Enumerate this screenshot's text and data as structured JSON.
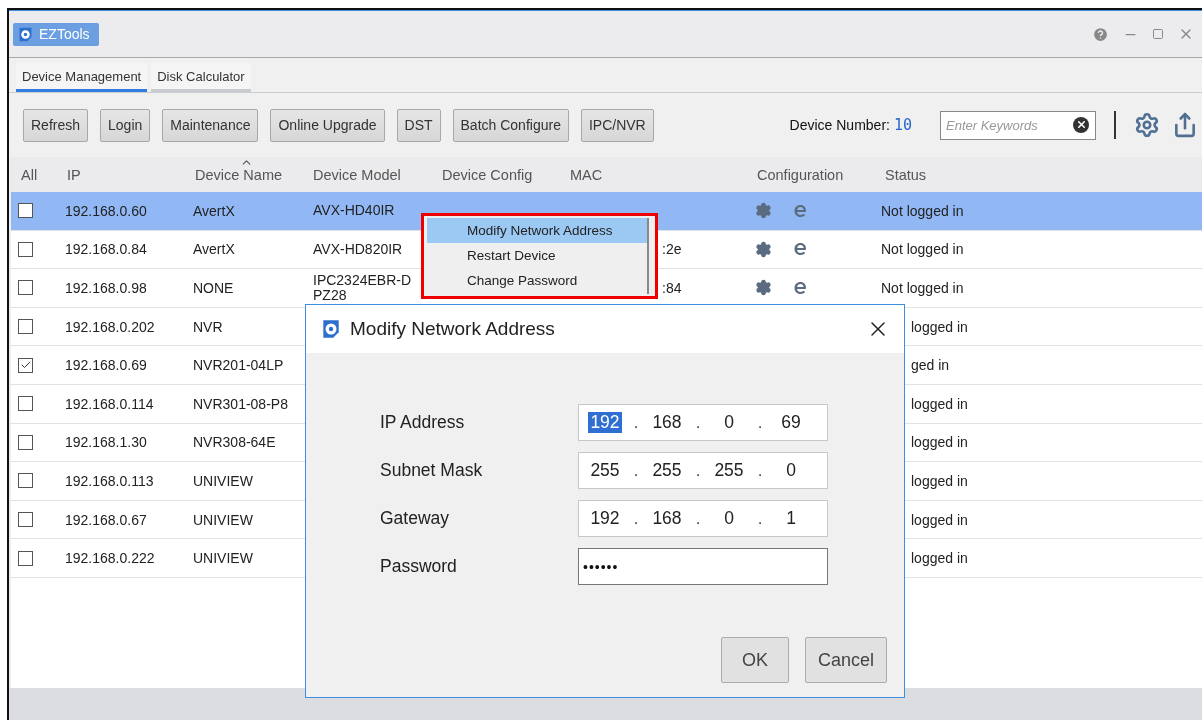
{
  "window": {
    "title": "EZTools"
  },
  "tabs": [
    {
      "label": "Device Management",
      "selected": true
    },
    {
      "label": "Disk Calculator",
      "selected": false
    }
  ],
  "toolbar": {
    "buttons": [
      "Refresh",
      "Login",
      "Maintenance",
      "Online Upgrade",
      "DST",
      "Batch Configure",
      "IPC/NVR"
    ],
    "device_number_label": "Device Number:",
    "device_number": "10",
    "search": {
      "placeholder": "Enter Keywords"
    }
  },
  "table": {
    "columns": [
      "All",
      "IP",
      "Device Name",
      "Device Model",
      "Device Config",
      "MAC",
      "Configuration",
      "Status"
    ],
    "rows": [
      {
        "checked": false,
        "selected": true,
        "covered": false,
        "ip": "192.168.0.60",
        "name": "AvertX",
        "model": "AVX-HD40IR",
        "status": "Not logged in"
      },
      {
        "checked": false,
        "selected": false,
        "covered": false,
        "ip": "192.168.0.84",
        "name": "AvertX",
        "model": "AVX-HD820IR",
        "mac": ":2e",
        "status": "Not logged in"
      },
      {
        "checked": false,
        "selected": false,
        "covered": false,
        "ip": "192.168.0.98",
        "name": "NONE",
        "model": "IPC2324EBR-DPZ28",
        "mac": ":84",
        "status": "Not logged in"
      },
      {
        "checked": false,
        "selected": false,
        "covered": true,
        "ip": "192.168.0.202",
        "name": "NVR",
        "status": "logged in"
      },
      {
        "checked": true,
        "selected": false,
        "covered": true,
        "ip": "192.168.0.69",
        "name": "NVR201-04LP",
        "status": "ged in"
      },
      {
        "checked": false,
        "selected": false,
        "covered": true,
        "ip": "192.168.0.114",
        "name": "NVR301-08-P8",
        "status": "logged in"
      },
      {
        "checked": false,
        "selected": false,
        "covered": true,
        "ip": "192.168.1.30",
        "name": "NVR308-64E",
        "status": "logged in"
      },
      {
        "checked": false,
        "selected": false,
        "covered": true,
        "ip": "192.168.0.113",
        "name": "UNIVIEW",
        "status": "logged in"
      },
      {
        "checked": false,
        "selected": false,
        "covered": true,
        "ip": "192.168.0.67",
        "name": "UNIVIEW",
        "status": "logged in"
      },
      {
        "checked": false,
        "selected": false,
        "covered": true,
        "ip": "192.168.0.222",
        "name": "UNIVIEW",
        "status": "logged in"
      }
    ]
  },
  "context_menu": {
    "items": [
      {
        "label": "Modify Network Address",
        "selected": true
      },
      {
        "label": "Restart Device",
        "selected": false
      },
      {
        "label": "Change Password",
        "selected": false
      }
    ]
  },
  "dialog": {
    "title": "Modify Network Address",
    "fields": [
      {
        "kind": "ip",
        "label": "IP Address",
        "separator": ".",
        "octets": [
          {
            "value": "192",
            "selected": true
          },
          {
            "value": "168",
            "selected": false
          },
          {
            "value": "0",
            "selected": false
          },
          {
            "value": "69",
            "selected": false
          }
        ]
      },
      {
        "kind": "ip",
        "label": "Subnet Mask",
        "separator": ".",
        "octets": [
          {
            "value": "255",
            "selected": false
          },
          {
            "value": "255",
            "selected": false
          },
          {
            "value": "255",
            "selected": false
          },
          {
            "value": "0",
            "selected": false
          }
        ]
      },
      {
        "kind": "ip",
        "label": "Gateway",
        "separator": ".",
        "octets": [
          {
            "value": "192",
            "selected": false
          },
          {
            "value": "168",
            "selected": false
          },
          {
            "value": "0",
            "selected": false
          },
          {
            "value": "1",
            "selected": false
          }
        ]
      },
      {
        "kind": "password",
        "label": "Password",
        "value": "••••••"
      }
    ],
    "buttons": [
      "OK",
      "Cancel"
    ]
  }
}
